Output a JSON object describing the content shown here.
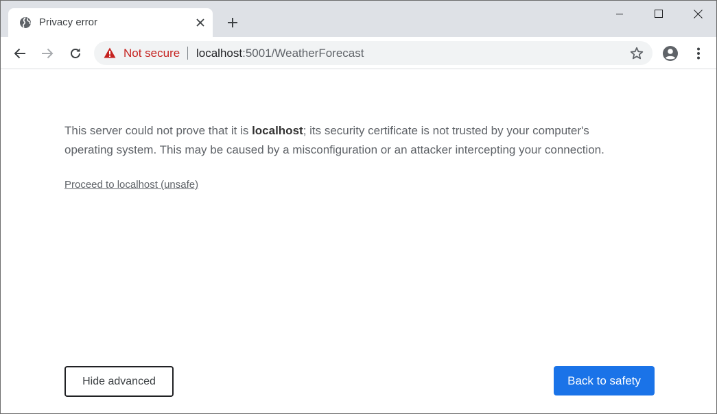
{
  "tab": {
    "title": "Privacy error"
  },
  "toolbar": {
    "security_label": "Not secure",
    "url_host": "localhost",
    "url_rest": ":5001/WeatherForecast"
  },
  "interstitial": {
    "message_before": "This server could not prove that it is ",
    "message_host": "localhost",
    "message_after": "; its security certificate is not trusted by your computer's operating system. This may be caused by a misconfiguration or an attacker intercepting your connection.",
    "proceed_link": "Proceed to localhost (unsafe)",
    "hide_advanced_label": "Hide advanced",
    "back_to_safety_label": "Back to safety"
  },
  "icons": {
    "favicon": "globe-icon",
    "tab_close": "close-icon",
    "new_tab": "plus-icon",
    "back": "arrow-left-icon",
    "forward": "arrow-right-icon",
    "reload": "reload-icon",
    "warning": "warning-triangle-icon",
    "bookmark": "star-icon",
    "profile": "account-circle-icon",
    "menu": "more-vert-icon"
  },
  "colors": {
    "not_secure": "#c5221f",
    "primary_button": "#1a73e8",
    "tabstrip_bg": "#dee1e6"
  }
}
